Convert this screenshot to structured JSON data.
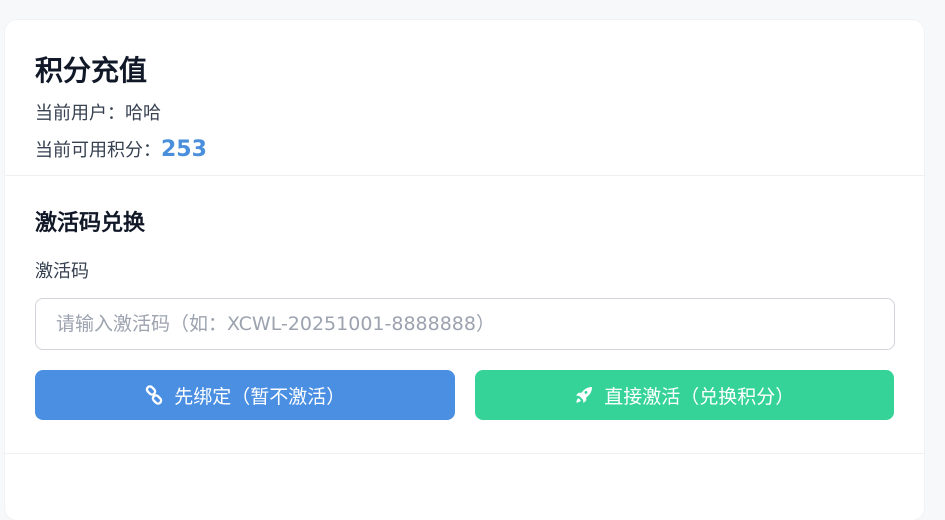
{
  "header": {
    "title": "积分充值",
    "user_label": "当前用户：",
    "user_name": "哈哈",
    "points_label": "当前可用积分：",
    "points_value": "253"
  },
  "redeem": {
    "section_title": "激活码兑换",
    "field_label": "激活码",
    "input_value": "",
    "input_placeholder": "请输入激活码（如：XCWL-20251001-8888888）",
    "bind_button_label": "先绑定（暂不激活）",
    "bind_button_icon": "link-icon",
    "activate_button_label": "直接激活（兑换积分）",
    "activate_button_icon": "rocket-icon"
  },
  "colors": {
    "accent_blue": "#4a8fe2",
    "accent_green": "#36d399",
    "points_color": "#4a8fdb"
  }
}
